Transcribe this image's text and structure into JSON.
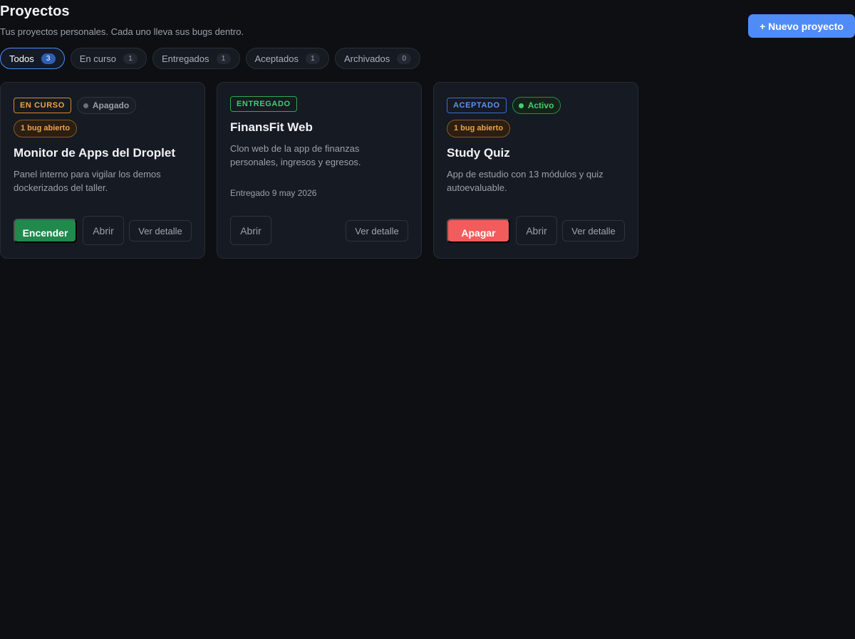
{
  "header": {
    "title": "Proyectos",
    "subtitle": "Tus proyectos personales. Cada uno lleva sus bugs dentro.",
    "new_project_label": "+ Nuevo proyecto"
  },
  "filters": [
    {
      "label": "Todos",
      "count": "3",
      "active": true
    },
    {
      "label": "En curso",
      "count": "1",
      "active": false
    },
    {
      "label": "Entregados",
      "count": "1",
      "active": false
    },
    {
      "label": "Aceptados",
      "count": "1",
      "active": false
    },
    {
      "label": "Archivados",
      "count": "0",
      "active": false
    }
  ],
  "projects": [
    {
      "status": "EN CURSO",
      "power": "Apagado",
      "bugs": "1 bug abierto",
      "title": "Monitor de Apps del Droplet",
      "description": "Panel interno para vigilar los demos dockerizados del taller.",
      "power_action": "Encender",
      "open_label": "Abrir",
      "detail_label": "Ver detalle"
    },
    {
      "status": "ENTREGADO",
      "title": "FinansFit Web",
      "description": "Clon web de la app de finanzas personales, ingresos y egresos.",
      "delivered": "Entregado 9 may 2026",
      "open_label": "Abrir",
      "detail_label": "Ver detalle"
    },
    {
      "status": "ACEPTADO",
      "power": "Activo",
      "bugs": "1 bug abierto",
      "title": "Study Quiz",
      "description": "App de estudio con 13 módulos y quiz autoevaluable.",
      "power_action": "Apagar",
      "open_label": "Abrir",
      "detail_label": "Ver detalle"
    }
  ],
  "colors": {
    "background": "#0d0f13",
    "card": "#161a22",
    "accent": "#4f8cf7",
    "status_en_curso": "#f0a24a",
    "status_entregado": "#3fcf6a",
    "status_aceptado": "#5c92f5",
    "start_button": "#1f8a4c",
    "stop_button": "#f25c5c"
  }
}
